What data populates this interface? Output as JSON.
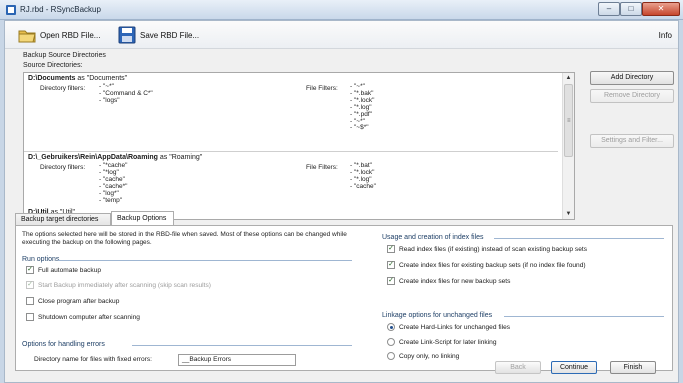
{
  "window": {
    "title": "RJ.rbd - RSyncBackup",
    "min": "–",
    "max": "□",
    "close": "✕"
  },
  "toolbar": {
    "open_label": "Open RBD File...",
    "save_label": "Save RBD File...",
    "info_label": "Info"
  },
  "source": {
    "section_label": "Backup Source Directories",
    "list_label": "Source Directories:",
    "directories": [
      {
        "path": "D:\\Documents",
        "as": "as",
        "alias": "\"Documents\"",
        "dir_filters_label": "Directory filters:",
        "dir_filters": [
          "- \"~*\"",
          "- \"Command & C*\"",
          "- \"logs\""
        ],
        "file_filters_label": "File Filters:",
        "file_filters": [
          "- \"~*\"",
          "- \"*.bak\"",
          "- \"*.lock\"",
          "- \"*.log\"",
          "- \"*.pdf\"",
          "- \"~*\"",
          "- \"~$*\""
        ]
      },
      {
        "path": "D:\\_Gebruikers\\Rein\\AppData\\Roaming",
        "as": "as",
        "alias": "\"Roaming\"",
        "dir_filters_label": "Directory filters:",
        "dir_filters": [
          "- \"*cache\"",
          "- \"*log\"",
          "- \"cache\"",
          "- \"cache*\"",
          "- \"log*\"",
          "- \"temp\""
        ],
        "file_filters_label": "File Filters:",
        "file_filters": [
          "- \"*.bat\"",
          "- \"*.lock\"",
          "- \"*.log\"",
          "- \"cache\""
        ]
      },
      {
        "path": "D:\\Util",
        "as": "as",
        "alias": "\"Util\""
      }
    ],
    "buttons": {
      "add": "Add Directory",
      "remove": "Remove Directory",
      "settings": "Settings and Filter..."
    }
  },
  "tabs": [
    {
      "label": "Backup target directories"
    },
    {
      "label": "Backup Options"
    }
  ],
  "options": {
    "intro": "The options selected here will be stored in the RBD-file when saved. Most of these options can be changed while executing the backup on the following pages.",
    "run_options_title": "Run options",
    "run_options": [
      {
        "label": "Full automate backup",
        "checked": true,
        "enabled": true
      },
      {
        "label": "Start Backup immediately after scanning (skip scan results)",
        "checked": true,
        "enabled": false
      },
      {
        "label": "Close program after backup",
        "checked": false,
        "enabled": true
      },
      {
        "label": "Shutdown computer after scanning",
        "checked": false,
        "enabled": true
      }
    ],
    "errors_title": "Options for handling errors",
    "errors_dir_label": "Directory name for files with fixed errors:",
    "errors_dir_value": "__Backup Errors",
    "index_title": "Usage and creation of index files",
    "index_options": [
      {
        "label": "Read index files (if existing) instead of scan existing backup sets",
        "checked": true
      },
      {
        "label": "Create index files for existing backup sets (if no index file found)",
        "checked": true
      },
      {
        "label": "Create index files for new backup sets",
        "checked": true
      }
    ],
    "linkage_title": "Linkage options for unchanged files",
    "linkage_options": [
      {
        "label": "Create Hard-Links for unchanged files",
        "selected": true
      },
      {
        "label": "Create Link-Script for later linking",
        "selected": false
      },
      {
        "label": "Copy only, no linking",
        "selected": false
      }
    ]
  },
  "footer": {
    "back": "Back",
    "continue": "Continue",
    "finish": "Finish"
  }
}
